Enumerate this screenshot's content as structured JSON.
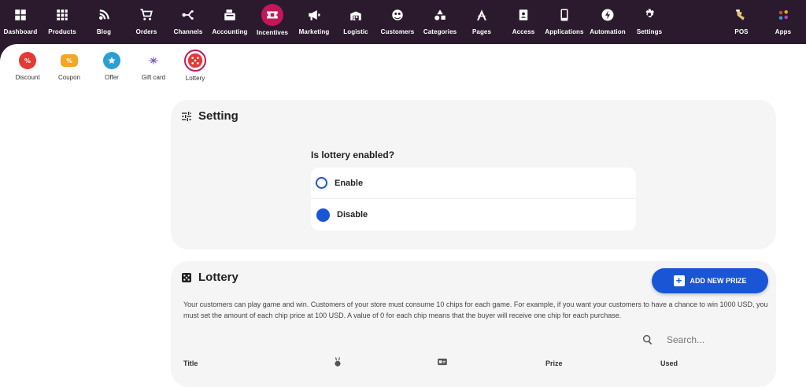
{
  "topnav": {
    "items": [
      {
        "label": "Dashboard",
        "icon": "dashboard-icon"
      },
      {
        "label": "Products",
        "icon": "products-icon"
      },
      {
        "label": "Blog",
        "icon": "blog-icon"
      },
      {
        "label": "Orders",
        "icon": "cart-icon"
      },
      {
        "label": "Channels",
        "icon": "channels-icon"
      },
      {
        "label": "Accounting",
        "icon": "register-icon"
      },
      {
        "label": "Incentives",
        "icon": "ticket-icon",
        "active": true
      },
      {
        "label": "Marketing",
        "icon": "megaphone-icon"
      },
      {
        "label": "Logistic",
        "icon": "warehouse-icon"
      },
      {
        "label": "Customers",
        "icon": "customers-icon"
      },
      {
        "label": "Categories",
        "icon": "categories-icon"
      },
      {
        "label": "Pages",
        "icon": "pages-icon"
      },
      {
        "label": "Access",
        "icon": "access-icon"
      },
      {
        "label": "Applications",
        "icon": "phone-icon"
      },
      {
        "label": "Automation",
        "icon": "bolt-icon"
      },
      {
        "label": "Settings",
        "icon": "gear-icon"
      },
      {
        "label": "POS",
        "icon": "pos-icon"
      },
      {
        "label": "Apps",
        "icon": "apps-icon"
      }
    ]
  },
  "subnav": {
    "items": [
      {
        "label": "Discount",
        "icon": "discount-icon",
        "color": "#e53935"
      },
      {
        "label": "Coupon",
        "icon": "coupon-icon",
        "color": "#f5a623"
      },
      {
        "label": "Offer",
        "icon": "offer-icon",
        "color": "#2a9fd6"
      },
      {
        "label": "Gift card",
        "icon": "gift-card-icon",
        "color": "#7e57c2"
      },
      {
        "label": "Lottery",
        "icon": "dice-icon",
        "color": "#e53935",
        "active": true
      }
    ]
  },
  "setting": {
    "title": "Setting",
    "question": "Is lottery enabled?",
    "options": [
      {
        "label": "Enable",
        "checked": false
      },
      {
        "label": "Disable",
        "checked": true
      }
    ]
  },
  "lottery": {
    "title": "Lottery",
    "add_button": "ADD NEW PRIZE",
    "description": "Your customers can play game and win. Customers of your store must consume 10 chips for each game. For example, if you want your customers to have a chance to win 1000 USD, you must set the amount of each chip price at 100 USD. A value of 0 for each chip means that the buyer will receive one chip for each purchase.",
    "search_placeholder": "Search...",
    "columns": [
      "Title",
      "Prize",
      "Used"
    ]
  },
  "colors": {
    "nav_bg": "#2b1a2e",
    "active_accent": "#c2185b",
    "primary": "#1a55d6"
  }
}
